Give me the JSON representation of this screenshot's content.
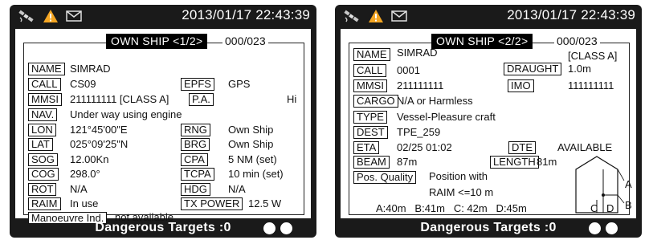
{
  "screen1": {
    "datetime": "2013/01/17 22:43:39",
    "title": "OWN SHIP <1/2>",
    "count": "000/023",
    "name_label": "NAME",
    "name_value": "SIMRAD",
    "call_label": "CALL",
    "call_value": "CS09",
    "epfs_label": "EPFS",
    "epfs_value": "GPS",
    "mmsi_label": "MMSI",
    "mmsi_value": "211111111 [CLASS A]",
    "pa_label": "P.A.",
    "pa_value": "Hi",
    "nav_label": "NAV.",
    "nav_value": "Under way using engine",
    "lon_label": "LON",
    "lon_value": "121°45'00\"E",
    "rng_label": "RNG",
    "rng_value": "Own Ship",
    "lat_label": "LAT",
    "lat_value": "025°09'25\"N",
    "brg_label": "BRG",
    "brg_value": "Own Ship",
    "sog_label": "SOG",
    "sog_value": "12.00Kn",
    "cpa_label": "CPA",
    "cpa_value": "5 NM (set)",
    "cog_label": "COG",
    "cog_value": "298.0°",
    "tcpa_label": "TCPA",
    "tcpa_value": "10 min (set)",
    "rot_label": "ROT",
    "rot_value": "N/A",
    "hdg_label": "HDG",
    "hdg_value": "N/A",
    "raim_label": "RAIM",
    "raim_value": "In use",
    "txpower_label": "TX POWER",
    "txpower_value": "12.5 W",
    "manoeuvre_label": "Manoeuvre Ind.",
    "manoeuvre_value": "not available",
    "dangerous_targets": "Dangerous Targets :0"
  },
  "screen2": {
    "datetime": "2013/01/17 22:43:39",
    "title": "OWN SHIP <2/2>",
    "count": "000/023",
    "class_value": "[CLASS A]",
    "name_label": "NAME",
    "name_value": "SIMRAD",
    "call_label": "CALL",
    "call_value": "0001",
    "draught_label": "DRAUGHT",
    "draught_value": "1.0m",
    "mmsi_label": "MMSI",
    "mmsi_value": "211111111",
    "imo_label": "IMO",
    "imo_value": "111111111",
    "cargo_label": "CARGO",
    "cargo_value": "N/A or Harmless",
    "type_label": "TYPE",
    "type_value": "Vessel-Pleasure craft",
    "dest_label": "DEST",
    "dest_value": "TPE_259",
    "eta_label": "ETA",
    "eta_value": "02/25 01:02",
    "dte_label": "DTE",
    "dte_value": "AVAILABLE",
    "beam_label": "BEAM",
    "beam_value": "87m",
    "length_label": "LENGTH",
    "length_value": "81m",
    "posq_label": "Pos. Quality",
    "posq_value": "Position with",
    "raim_line": "RAIM <=10 m",
    "dims_line": "A:40m   B:41m   C: 42m   D:45m",
    "diagram_a": "A",
    "diagram_b": "B",
    "diagram_c": "C",
    "diagram_d": "D",
    "dangerous_targets": "Dangerous Targets :0"
  },
  "colors": {
    "background": "#1a1a1a",
    "warning": "#f5a623",
    "panel": "#ffffff"
  },
  "icons": [
    "satellite-icon",
    "warning-icon",
    "envelope-icon"
  ]
}
